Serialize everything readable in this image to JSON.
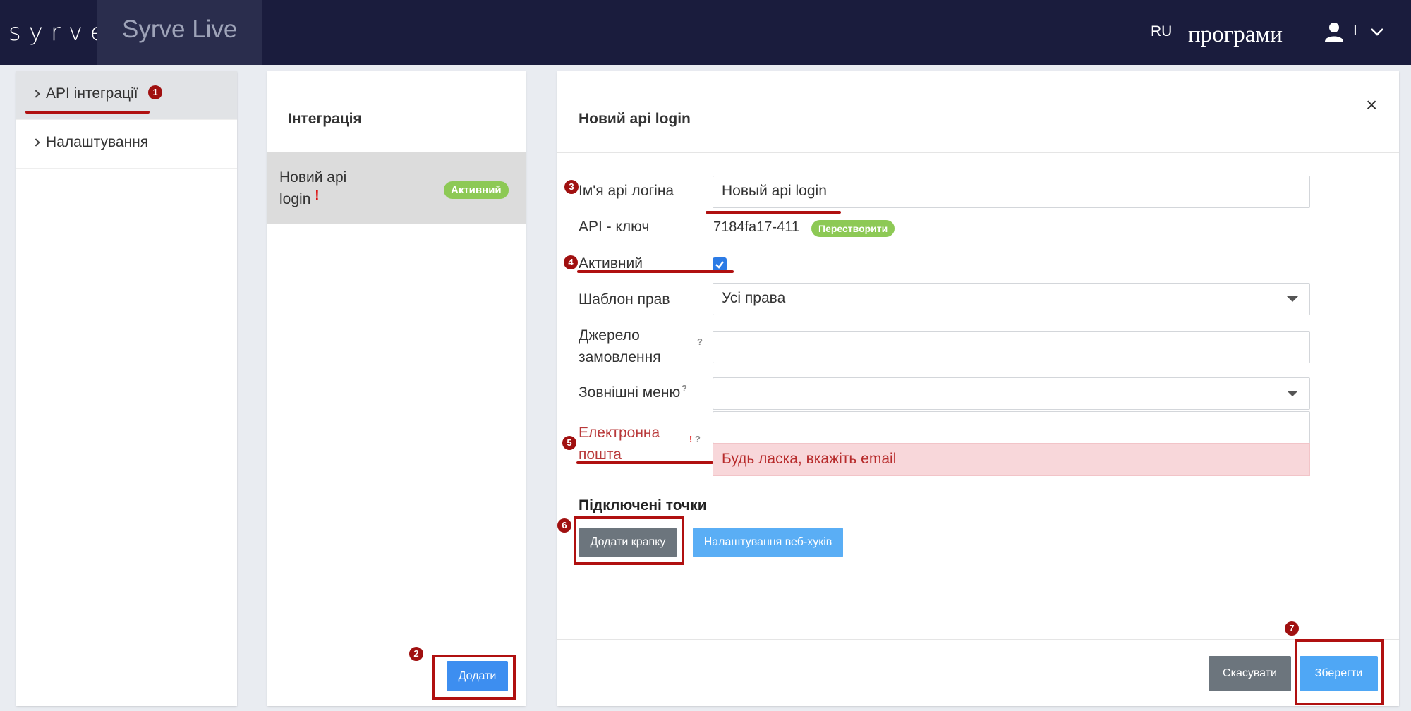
{
  "header": {
    "logo": "syrve",
    "brand": "Syrve Live",
    "language": "RU",
    "programs": "програми",
    "user_initial": "I"
  },
  "sidebar": {
    "items": [
      {
        "label": "API інтеграції"
      },
      {
        "label": "Налаштування"
      }
    ]
  },
  "integrations": {
    "title": "Інтеграція",
    "rows": [
      {
        "name": "Новий api login",
        "warning": "!",
        "status": "Активний"
      }
    ],
    "add_button": "Додати"
  },
  "form": {
    "title": "Новий api login",
    "close": "×",
    "login_name_label": "Ім'я api логіна",
    "login_name_value": "Новый api login",
    "api_key_label": "API - ключ",
    "api_key_value": "7184fa17-411",
    "regenerate_label": "Перестворити",
    "active_label": "Активний",
    "active_checked": true,
    "rights_template_label": "Шаблон прав",
    "rights_template_value": "Усі права",
    "order_source_label": "Джерело замовлення",
    "order_source_value": "",
    "external_menu_label": "Зовнішні меню",
    "external_menu_value": "",
    "email_label": "Електронна пошта",
    "email_value": "",
    "email_error": "Будь ласка, вкажіть email",
    "help_mark": "?",
    "error_mark": "!",
    "connected_points_title": "Підключені точки",
    "add_point_button": "Додати крапку",
    "webhooks_button": "Налаштування веб-хуків",
    "cancel_button": "Скасувати",
    "save_button": "Зберегти"
  },
  "annotations": [
    "1",
    "2",
    "3",
    "4",
    "5",
    "6",
    "7"
  ],
  "colors": {
    "topbar": "#1a1c3d",
    "accent_blue": "#3d8ef0",
    "success_green": "#8dc955",
    "annotation_red": "#b01010",
    "error_bg": "#f8d7da"
  }
}
